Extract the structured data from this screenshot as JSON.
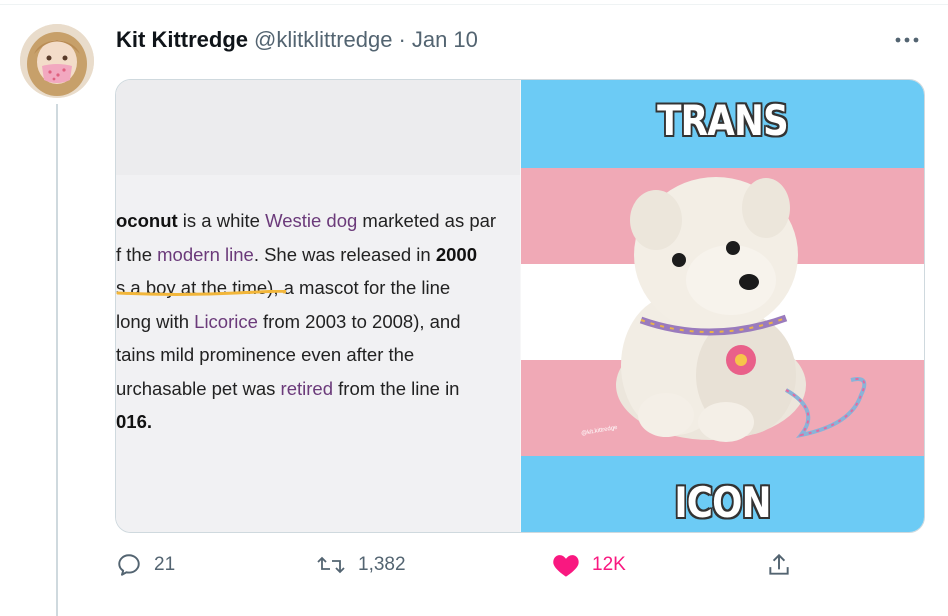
{
  "tweet": {
    "display_name": "Kit Kittredge",
    "handle": "@klitklittredge",
    "separator": "·",
    "date": "Jan 10"
  },
  "media": {
    "article_lines": [
      [
        {
          "text": "oconut",
          "style": "bold"
        },
        {
          "text": " is a white "
        },
        {
          "text": "Westie dog",
          "style": "link"
        },
        {
          "text": " marketed as par"
        }
      ],
      [
        {
          "text": "f the "
        },
        {
          "text": "modern line",
          "style": "link"
        },
        {
          "text": ". She was released in "
        },
        {
          "text": "2000",
          "style": "bold"
        }
      ],
      [
        {
          "text": "s a boy at the time"
        },
        {
          "text": "), a mascot for the line"
        }
      ],
      [
        {
          "text": "long with "
        },
        {
          "text": "Licorice",
          "style": "link"
        },
        {
          "text": " from 2003 to 2008), and"
        }
      ],
      [
        {
          "text": "tains mild prominence even after the"
        }
      ],
      [
        {
          "text": "urchasable pet was "
        },
        {
          "text": "retired",
          "style": "link"
        },
        {
          "text": " from the line in"
        }
      ],
      [
        {
          "text": "016.",
          "style": "bold"
        }
      ]
    ],
    "meme_top": "TRANS",
    "meme_bottom": "ICON",
    "watermark": "@kit.kittredge",
    "flag_colors": {
      "blue": "#5BCEFA",
      "pink": "#F5A9B8",
      "white": "#FFFFFF"
    },
    "underline_color": "#f2b63a",
    "link_color": "#6b3a7a"
  },
  "actions": {
    "reply_count": "21",
    "retweet_count": "1,382",
    "like_count": "12K",
    "like_color": "#f91880",
    "icons": [
      "reply-icon",
      "retweet-icon",
      "heart-icon",
      "share-icon"
    ]
  }
}
